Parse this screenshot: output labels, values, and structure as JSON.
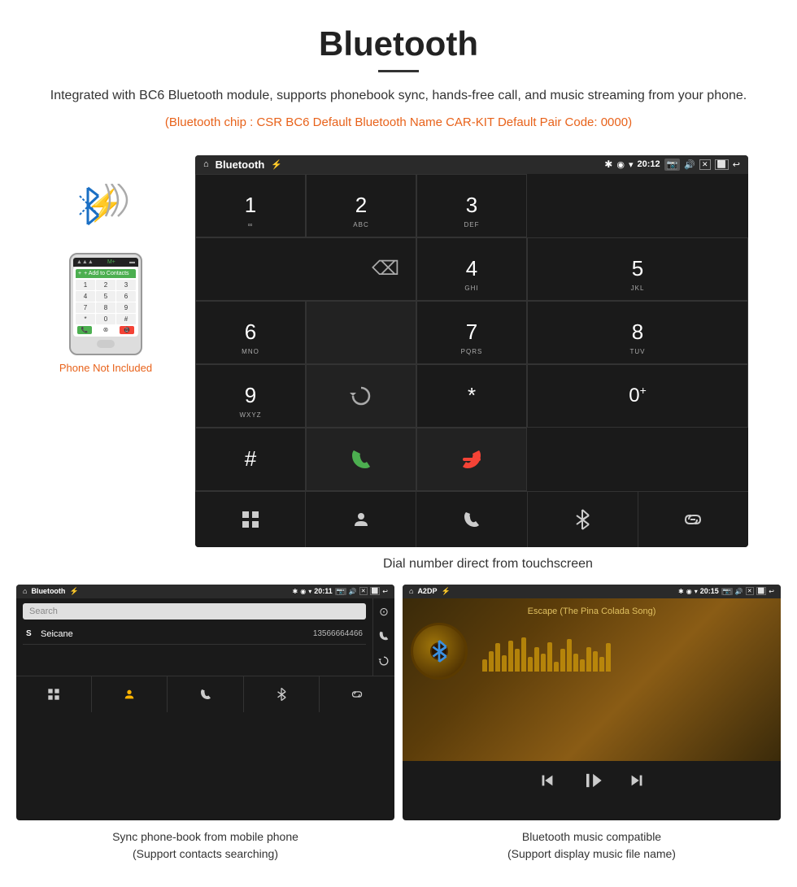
{
  "header": {
    "title": "Bluetooth",
    "description": "Integrated with BC6 Bluetooth module, supports phonebook sync, hands-free call, and music streaming from your phone.",
    "specs": "(Bluetooth chip : CSR BC6    Default Bluetooth Name CAR-KIT    Default Pair Code: 0000)"
  },
  "android_dial": {
    "statusbar": {
      "app_name": "Bluetooth",
      "time": "20:12"
    },
    "keys": [
      {
        "num": "1",
        "sub": "∞"
      },
      {
        "num": "2",
        "sub": "ABC"
      },
      {
        "num": "3",
        "sub": "DEF"
      },
      {
        "num": "4",
        "sub": "GHI"
      },
      {
        "num": "5",
        "sub": "JKL"
      },
      {
        "num": "6",
        "sub": "MNO"
      },
      {
        "num": "7",
        "sub": "PQRS"
      },
      {
        "num": "8",
        "sub": "TUV"
      },
      {
        "num": "9",
        "sub": "WXYZ"
      },
      {
        "num": "*",
        "sub": ""
      },
      {
        "num": "0",
        "sub": "+"
      },
      {
        "num": "#",
        "sub": ""
      }
    ]
  },
  "dial_caption": "Dial number direct from touchscreen",
  "phone": {
    "not_included_label": "Phone Not Included",
    "add_contacts_label": "+ Add to Contacts",
    "numbers": [
      "1",
      "2",
      "3",
      "4",
      "5",
      "6",
      "7",
      "8",
      "9",
      "*",
      "0",
      "#"
    ]
  },
  "phonebook": {
    "statusbar": {
      "app_name": "Bluetooth",
      "time": "20:11"
    },
    "search_placeholder": "Search",
    "contacts": [
      {
        "letter": "S",
        "name": "Seicane",
        "number": "13566664466"
      }
    ],
    "caption_line1": "Sync phone-book from mobile phone",
    "caption_line2": "(Support contacts searching)"
  },
  "music": {
    "statusbar": {
      "app_name": "A2DP",
      "time": "20:15"
    },
    "song_title": "Escape (The Pina Colada Song)",
    "eq_heights": [
      15,
      25,
      35,
      20,
      38,
      28,
      42,
      18,
      30,
      22,
      36,
      12,
      28,
      40,
      22,
      15,
      30,
      25,
      18,
      35
    ],
    "caption_line1": "Bluetooth music compatible",
    "caption_line2": "(Support display music file name)"
  },
  "icons": {
    "home": "⌂",
    "bluetooth": "✱",
    "usb": "⚡",
    "bt_symbol": "⬡",
    "search": "⊙",
    "call": "📞",
    "redial": "↻",
    "backspace": "⌫",
    "grid": "⊞",
    "person": "👤",
    "phone_call": "📞",
    "bt_icon": "✱",
    "link": "🔗",
    "prev": "⏮",
    "play": "⏯",
    "next": "⏭",
    "camera": "📷",
    "volume": "🔊",
    "close": "✕",
    "window": "⬜",
    "back": "↩",
    "signal": "▲",
    "wifi": "▾",
    "battery": "▬",
    "location": "◉"
  }
}
